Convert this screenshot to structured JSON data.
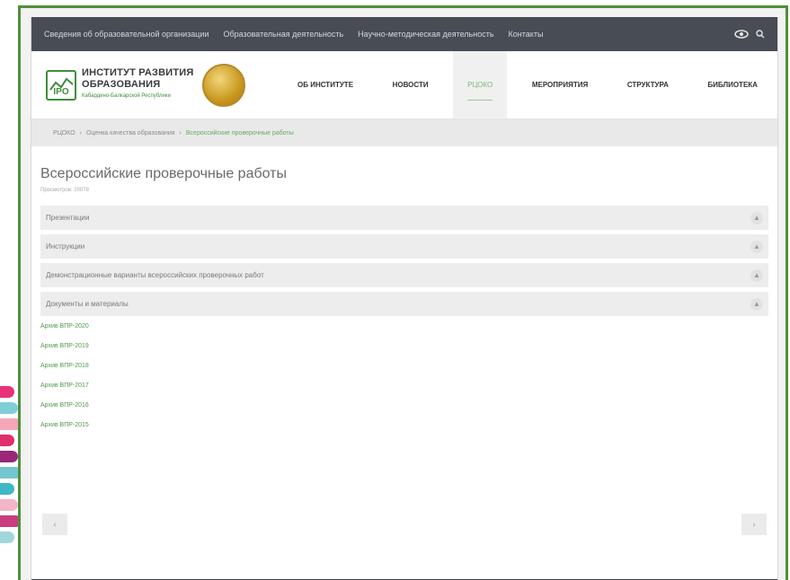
{
  "decor": {
    "stripe_colors": [
      "#e8327a",
      "#7fd0d6",
      "#f5a7b8",
      "#e02f6b",
      "#9a2878",
      "#74c7cf",
      "#3fb8c6",
      "#f3b6c9",
      "#c93d7f",
      "#9fd7db"
    ]
  },
  "topbar": {
    "links": [
      "Сведения об образовательной организации",
      "Образовательная деятельность",
      "Научно-методическая деятельность",
      "Контакты"
    ],
    "icons": [
      "eye-icon",
      "search-icon"
    ]
  },
  "header": {
    "logo_mark": "IPO",
    "logo_title_line1": "ИНСТИТУТ РАЗВИТИЯ",
    "logo_title_line2": "ОБРАЗОВАНИЯ",
    "logo_sub": "Кабардино-Балкарской Республики",
    "nav": [
      {
        "label": "ОБ ИНСТИТУТЕ",
        "active": false
      },
      {
        "label": "НОВОСТИ",
        "active": false
      },
      {
        "label": "РЦОКО",
        "active": true
      },
      {
        "label": "МЕРОПРИЯТИЯ",
        "active": false
      },
      {
        "label": "СТРУКТУРА",
        "active": false
      },
      {
        "label": "БИБЛИОТЕКА",
        "active": false
      }
    ]
  },
  "breadcrumb": {
    "items": [
      "РЦОКО",
      "Оценка качества образования",
      "Всероссийские проверочные работы"
    ]
  },
  "main": {
    "title": "Всероссийские проверочные работы",
    "date": "Просмотров: 20078",
    "accordion": [
      "Презентации",
      "Инструкции",
      "Демонстрационные варианты всероссийских проверочных работ",
      "Документы и материалы"
    ],
    "links": [
      "Архив ВПР-2020",
      "Архив ВПР-2019",
      "Архив ВПР-2018",
      "Архив ВПР-2017",
      "Архив ВПР-2016",
      "Архив ВПР-2015"
    ]
  },
  "pager": {
    "prev": "‹",
    "next": "›"
  }
}
